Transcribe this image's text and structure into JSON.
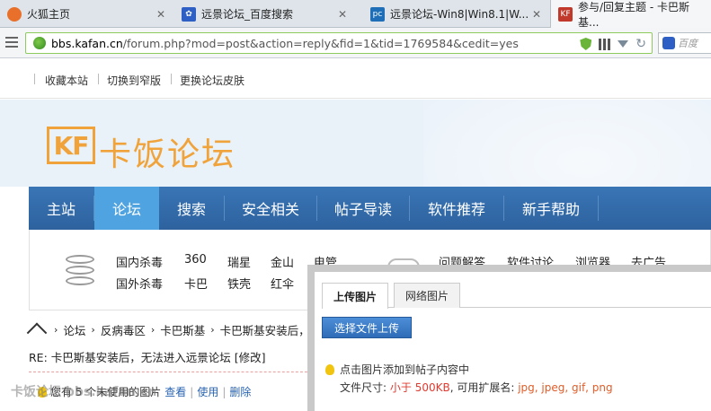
{
  "browser": {
    "tabs": [
      {
        "title": "火狐主页",
        "favicon_color": "#e8702a"
      },
      {
        "title": "远景论坛_百度搜索",
        "favicon_color": "#2d5fc4"
      },
      {
        "title": "远景论坛-Win8|Win8.1|W...",
        "favicon_color": "#1e6fb8"
      },
      {
        "title": "参与/回复主题 - 卡巴斯基...",
        "favicon_color": "#c0392b"
      }
    ],
    "url_domain": "bbs.kafan.cn",
    "url_path": "/forum.php?mod=post&action=reply&fid=1&tid=1769584&cedit=yes",
    "search_placeholder": "百度"
  },
  "toplinks": [
    "收藏本站",
    "切换到窄版",
    "更换论坛皮肤"
  ],
  "banner": {
    "logo_mark": "KF",
    "logo_text": "卡饭论坛",
    "accent": "#f0a33a"
  },
  "mainnav": {
    "items": [
      "主站",
      "论坛",
      "搜索",
      "安全相关",
      "帖子导读",
      "软件推荐",
      "新手帮助"
    ],
    "active_index": 1
  },
  "subnav": {
    "row1_left": [
      "国内杀毒",
      "360",
      "瑞星",
      "金山",
      "电管"
    ],
    "row2_left": [
      "国外杀毒",
      "卡巴",
      "铁壳",
      "红伞"
    ],
    "row1_right": [
      "问题解答",
      "软件讨论",
      "浏览器",
      "去广告"
    ]
  },
  "breadcrumb": [
    "论坛",
    "反病毒区",
    "卡巴斯基",
    "卡巴斯基安装后，无"
  ],
  "post_title": "RE: 卡巴斯基安装后，无法进入远景论坛 [修改]",
  "attachments": {
    "text": "您有 5 个未使用的图片",
    "view": "查看",
    "use": "使用",
    "delete": "删除"
  },
  "watermark": "卡饭论坛 bbs.kafan.cn",
  "upload_dialog": {
    "tabs": [
      "上传图片",
      "网络图片"
    ],
    "active_tab": 0,
    "button": "选择文件上传",
    "hint": "点击图片添加到帖子内容中",
    "size_label": "文件尺寸:",
    "size_value": "小于 500KB",
    "ext_label": ", 可用扩展名:",
    "ext_value": "jpg, jpeg, gif, png"
  }
}
